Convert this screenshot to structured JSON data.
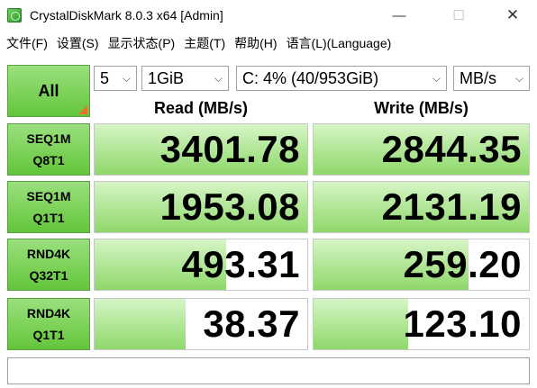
{
  "window": {
    "title": "CrystalDiskMark 8.0.3 x64 [Admin]",
    "icon": "crystaldiskmark-icon",
    "min_glyph": "—",
    "max_glyph": "☐",
    "close_glyph": "✕"
  },
  "menu": [
    "文件(F)",
    "设置(S)",
    "显示状态(P)",
    "主题(T)",
    "帮助(H)",
    "语言(L)(Language)"
  ],
  "toolbar": {
    "all_label": "All",
    "count": "5",
    "size": "1GiB",
    "drive": "C: 4% (40/953GiB)",
    "unit": "MB/s"
  },
  "headers": {
    "read": "Read (MB/s)",
    "write": "Write (MB/s)"
  },
  "rows": [
    {
      "line1": "SEQ1M",
      "line2": "Q8T1",
      "read": "3401.78",
      "write": "2844.35",
      "read_fill": 1.0,
      "write_fill": 1.0
    },
    {
      "line1": "SEQ1M",
      "line2": "Q1T1",
      "read": "1953.08",
      "write": "2131.19",
      "read_fill": 1.0,
      "write_fill": 1.0
    },
    {
      "line1": "RND4K",
      "line2": "Q32T1",
      "read": "493.31",
      "write": "259.20",
      "read_fill": 0.62,
      "write_fill": 0.72
    },
    {
      "line1": "RND4K",
      "line2": "Q1T1",
      "read": "38.37",
      "write": "123.10",
      "read_fill": 0.43,
      "write_fill": 0.44
    }
  ],
  "comment": "",
  "colors": {
    "accent_green": "#63c63a",
    "bar_green": "#8ed86a",
    "corner_orange": "#e8722a"
  }
}
